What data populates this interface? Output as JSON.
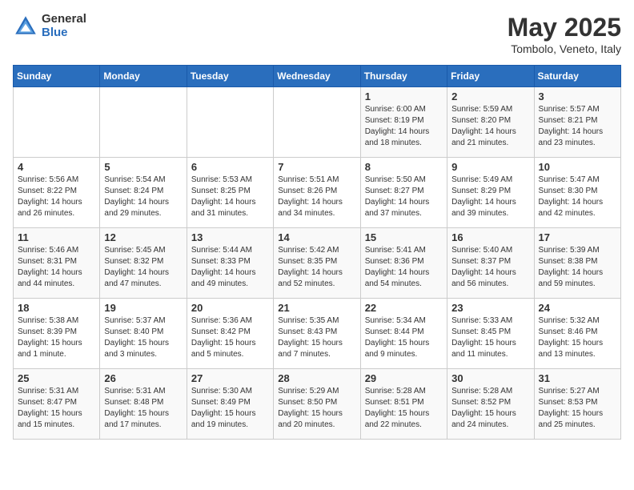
{
  "header": {
    "logo_general": "General",
    "logo_blue": "Blue",
    "month_title": "May 2025",
    "subtitle": "Tombolo, Veneto, Italy"
  },
  "days_of_week": [
    "Sunday",
    "Monday",
    "Tuesday",
    "Wednesday",
    "Thursday",
    "Friday",
    "Saturday"
  ],
  "weeks": [
    [
      {
        "num": "",
        "info": ""
      },
      {
        "num": "",
        "info": ""
      },
      {
        "num": "",
        "info": ""
      },
      {
        "num": "",
        "info": ""
      },
      {
        "num": "1",
        "info": "Sunrise: 6:00 AM\nSunset: 8:19 PM\nDaylight: 14 hours\nand 18 minutes."
      },
      {
        "num": "2",
        "info": "Sunrise: 5:59 AM\nSunset: 8:20 PM\nDaylight: 14 hours\nand 21 minutes."
      },
      {
        "num": "3",
        "info": "Sunrise: 5:57 AM\nSunset: 8:21 PM\nDaylight: 14 hours\nand 23 minutes."
      }
    ],
    [
      {
        "num": "4",
        "info": "Sunrise: 5:56 AM\nSunset: 8:22 PM\nDaylight: 14 hours\nand 26 minutes."
      },
      {
        "num": "5",
        "info": "Sunrise: 5:54 AM\nSunset: 8:24 PM\nDaylight: 14 hours\nand 29 minutes."
      },
      {
        "num": "6",
        "info": "Sunrise: 5:53 AM\nSunset: 8:25 PM\nDaylight: 14 hours\nand 31 minutes."
      },
      {
        "num": "7",
        "info": "Sunrise: 5:51 AM\nSunset: 8:26 PM\nDaylight: 14 hours\nand 34 minutes."
      },
      {
        "num": "8",
        "info": "Sunrise: 5:50 AM\nSunset: 8:27 PM\nDaylight: 14 hours\nand 37 minutes."
      },
      {
        "num": "9",
        "info": "Sunrise: 5:49 AM\nSunset: 8:29 PM\nDaylight: 14 hours\nand 39 minutes."
      },
      {
        "num": "10",
        "info": "Sunrise: 5:47 AM\nSunset: 8:30 PM\nDaylight: 14 hours\nand 42 minutes."
      }
    ],
    [
      {
        "num": "11",
        "info": "Sunrise: 5:46 AM\nSunset: 8:31 PM\nDaylight: 14 hours\nand 44 minutes."
      },
      {
        "num": "12",
        "info": "Sunrise: 5:45 AM\nSunset: 8:32 PM\nDaylight: 14 hours\nand 47 minutes."
      },
      {
        "num": "13",
        "info": "Sunrise: 5:44 AM\nSunset: 8:33 PM\nDaylight: 14 hours\nand 49 minutes."
      },
      {
        "num": "14",
        "info": "Sunrise: 5:42 AM\nSunset: 8:35 PM\nDaylight: 14 hours\nand 52 minutes."
      },
      {
        "num": "15",
        "info": "Sunrise: 5:41 AM\nSunset: 8:36 PM\nDaylight: 14 hours\nand 54 minutes."
      },
      {
        "num": "16",
        "info": "Sunrise: 5:40 AM\nSunset: 8:37 PM\nDaylight: 14 hours\nand 56 minutes."
      },
      {
        "num": "17",
        "info": "Sunrise: 5:39 AM\nSunset: 8:38 PM\nDaylight: 14 hours\nand 59 minutes."
      }
    ],
    [
      {
        "num": "18",
        "info": "Sunrise: 5:38 AM\nSunset: 8:39 PM\nDaylight: 15 hours\nand 1 minute."
      },
      {
        "num": "19",
        "info": "Sunrise: 5:37 AM\nSunset: 8:40 PM\nDaylight: 15 hours\nand 3 minutes."
      },
      {
        "num": "20",
        "info": "Sunrise: 5:36 AM\nSunset: 8:42 PM\nDaylight: 15 hours\nand 5 minutes."
      },
      {
        "num": "21",
        "info": "Sunrise: 5:35 AM\nSunset: 8:43 PM\nDaylight: 15 hours\nand 7 minutes."
      },
      {
        "num": "22",
        "info": "Sunrise: 5:34 AM\nSunset: 8:44 PM\nDaylight: 15 hours\nand 9 minutes."
      },
      {
        "num": "23",
        "info": "Sunrise: 5:33 AM\nSunset: 8:45 PM\nDaylight: 15 hours\nand 11 minutes."
      },
      {
        "num": "24",
        "info": "Sunrise: 5:32 AM\nSunset: 8:46 PM\nDaylight: 15 hours\nand 13 minutes."
      }
    ],
    [
      {
        "num": "25",
        "info": "Sunrise: 5:31 AM\nSunset: 8:47 PM\nDaylight: 15 hours\nand 15 minutes."
      },
      {
        "num": "26",
        "info": "Sunrise: 5:31 AM\nSunset: 8:48 PM\nDaylight: 15 hours\nand 17 minutes."
      },
      {
        "num": "27",
        "info": "Sunrise: 5:30 AM\nSunset: 8:49 PM\nDaylight: 15 hours\nand 19 minutes."
      },
      {
        "num": "28",
        "info": "Sunrise: 5:29 AM\nSunset: 8:50 PM\nDaylight: 15 hours\nand 20 minutes."
      },
      {
        "num": "29",
        "info": "Sunrise: 5:28 AM\nSunset: 8:51 PM\nDaylight: 15 hours\nand 22 minutes."
      },
      {
        "num": "30",
        "info": "Sunrise: 5:28 AM\nSunset: 8:52 PM\nDaylight: 15 hours\nand 24 minutes."
      },
      {
        "num": "31",
        "info": "Sunrise: 5:27 AM\nSunset: 8:53 PM\nDaylight: 15 hours\nand 25 minutes."
      }
    ]
  ]
}
